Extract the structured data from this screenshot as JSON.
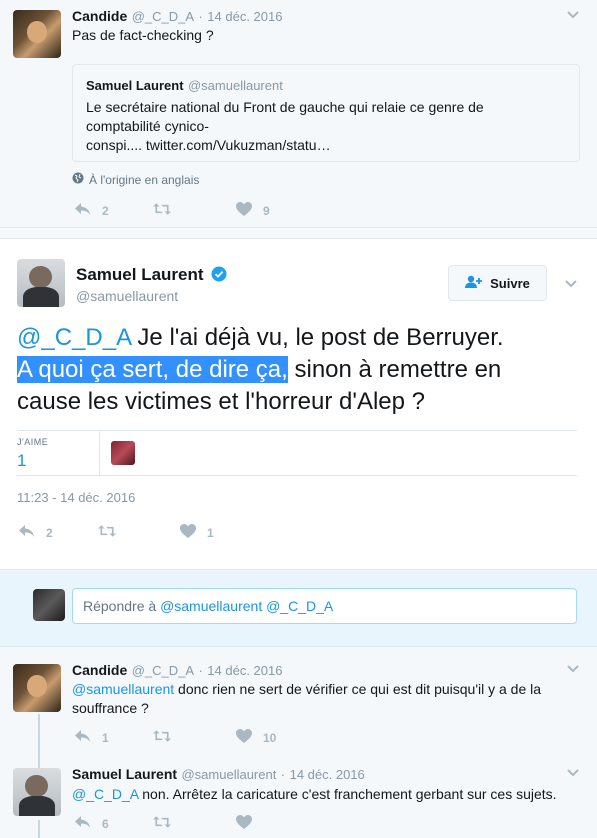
{
  "tweet1": {
    "name": "Candide",
    "handle": "@_C_D_A",
    "dot": "·",
    "date": "14 déc. 2016",
    "text": "Pas de fact-checking ?",
    "quote": {
      "name": "Samuel Laurent",
      "handle": "@samuellaurent",
      "text_line1": "Le secrétaire national du Front de gauche qui relaie ce genre de",
      "text_line2": "comptabilité cynico-",
      "text_line3": "conspi.... twitter.com/Vukuzman/statu…"
    },
    "translate": "À l'origine en anglais",
    "replies": "2",
    "retweets": "",
    "likes": "9"
  },
  "tweet2": {
    "name": "Samuel Laurent",
    "handle": "@samuellaurent",
    "follow_label": "Suivre",
    "text_mention": "@_C_D_A",
    "text_part1": " Je l'ai déjà vu, le post de Berruyer.",
    "text_highlight": "A quoi ça sert, de dire ça,",
    "text_part2": " sinon à remettre en",
    "text_part3": "cause les victimes et l'horreur d'Alep ?",
    "likes_label": "J'AIME",
    "likes_count": "1",
    "timestamp": "11:23 - 14 déc. 2016",
    "replies": "2",
    "retweets": "",
    "likes": "1"
  },
  "reply": {
    "prefix": "Répondre à ",
    "mentions": "@samuellaurent @_C_D_A"
  },
  "tweet3": {
    "name": "Candide",
    "handle": "@_C_D_A",
    "dot": "·",
    "date": "14 déc. 2016",
    "mention": "@samuellaurent",
    "text_line1": " donc rien ne sert de vérifier ce qui est dit puisqu'il y a de la",
    "text_line2": "souffrance ?",
    "replies": "1",
    "retweets": "",
    "likes": "10"
  },
  "tweet4": {
    "name": "Samuel Laurent",
    "handle": "@samuellaurent",
    "dot": "·",
    "date": "14 déc. 2016",
    "mention": "@_C_D_A",
    "text": " non. Arrêtez la caricature c'est franchement gerbant sur ces sujets.",
    "replies": "6",
    "retweets": "",
    "likes": ""
  },
  "icons": {
    "reply": "reply-icon",
    "retweet": "retweet-icon",
    "like": "heart-icon",
    "caret": "chevron-down-icon",
    "globe": "globe-icon",
    "verified": "verified-badge-icon",
    "follow": "follow-user-icon"
  },
  "colors": {
    "link": "#1b95e0",
    "muted": "#8899a6",
    "icon": "#aab8c2",
    "highlight": "#3390ff"
  }
}
